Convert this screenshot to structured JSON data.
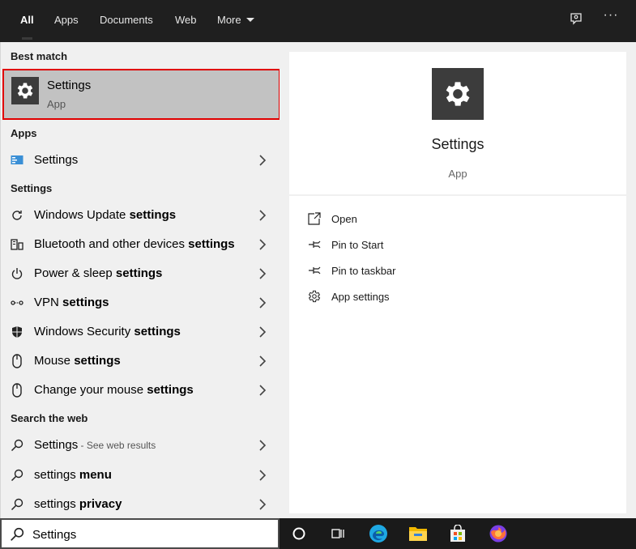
{
  "tabs": [
    {
      "label": "All"
    },
    {
      "label": "Apps"
    },
    {
      "label": "Documents"
    },
    {
      "label": "Web"
    },
    {
      "label": "More"
    }
  ],
  "topbar": {
    "overflow_label": "···"
  },
  "sections": {
    "best_match": "Best match",
    "apps": "Apps",
    "settings": "Settings",
    "search_web": "Search the web"
  },
  "best_match": {
    "title": "Settings",
    "subtitle": "App"
  },
  "apps": [
    {
      "label": "Settings"
    }
  ],
  "settings_results": [
    {
      "plain": "Windows Update ",
      "bold": "settings",
      "icon": "refresh-icon"
    },
    {
      "plain": "Bluetooth and other devices ",
      "bold": "settings",
      "icon": "devices-icon"
    },
    {
      "plain": "Power & sleep ",
      "bold": "settings",
      "icon": "power-icon"
    },
    {
      "plain": "VPN ",
      "bold": "settings",
      "icon": "vpn-icon"
    },
    {
      "plain": "Windows Security ",
      "bold": "settings",
      "icon": "shield-icon"
    },
    {
      "plain": "Mouse ",
      "bold": "settings",
      "icon": "mouse-icon"
    },
    {
      "plain": "Change your mouse ",
      "bold": "settings",
      "icon": "mouse-icon"
    }
  ],
  "web_results": [
    {
      "plain": "Settings",
      "hint": " - See web results",
      "bold": ""
    },
    {
      "plain": "settings ",
      "hint": "",
      "bold": "menu"
    },
    {
      "plain": "settings ",
      "hint": "",
      "bold": "privacy"
    }
  ],
  "preview": {
    "title": "Settings",
    "subtitle": "App"
  },
  "actions": [
    {
      "label": "Open",
      "icon": "open-icon"
    },
    {
      "label": "Pin to Start",
      "icon": "pin-icon"
    },
    {
      "label": "Pin to taskbar",
      "icon": "pin-icon"
    },
    {
      "label": "App settings",
      "icon": "gear-icon"
    }
  ],
  "search": {
    "value": "Settings"
  },
  "taskbar": [
    "cortana-icon",
    "task-view-icon",
    "edge-icon",
    "file-explorer-icon",
    "store-icon",
    "firefox-icon"
  ],
  "colors": {
    "highlight_border": "#e00000",
    "selected_bg": "#c2c2c2",
    "dark_bar": "#1f1f1f"
  }
}
